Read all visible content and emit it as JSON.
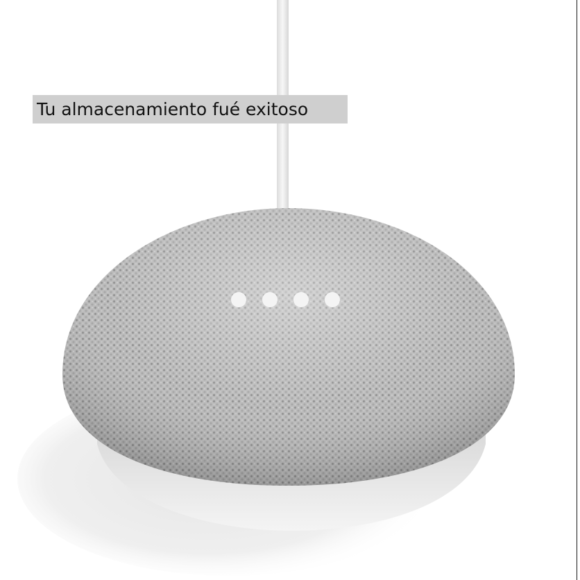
{
  "caption": {
    "text": "Tu almacenamiento fué exitoso"
  },
  "device": {
    "icon": "smart-speaker-icon",
    "indicator_lights": 4,
    "fabric_color": "#bdbdbd",
    "base_color": "#ededed",
    "cable_color": "#f0f0f0"
  }
}
